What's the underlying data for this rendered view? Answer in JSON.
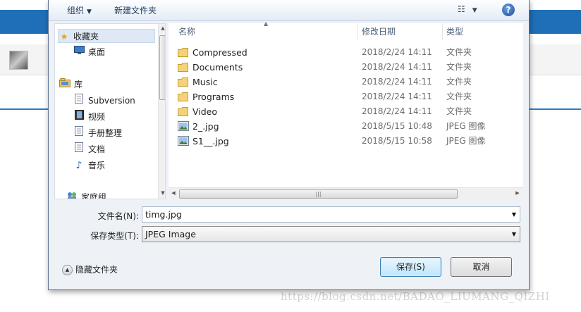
{
  "toolbar": {
    "organize": "组织",
    "new_folder": "新建文件夹",
    "help": "?"
  },
  "nav": {
    "items": [
      {
        "label": "收藏夹",
        "icon": "star-icon"
      },
      {
        "label": "桌面",
        "icon": "desktop-icon"
      },
      {
        "label": "库",
        "icon": "library-icon"
      },
      {
        "label": "Subversion",
        "icon": "document-icon"
      },
      {
        "label": "视频",
        "icon": "video-icon"
      },
      {
        "label": "手册整理",
        "icon": "document-icon"
      },
      {
        "label": "文档",
        "icon": "document-icon"
      },
      {
        "label": "音乐",
        "icon": "music-icon"
      },
      {
        "label": "家庭组",
        "icon": "homegroup-icon"
      }
    ]
  },
  "columns": {
    "name": "名称",
    "date": "修改日期",
    "type": "类型"
  },
  "files": [
    {
      "name": "Compressed",
      "date": "2018/2/24 14:11",
      "type": "文件夹",
      "icon": "folder-icon"
    },
    {
      "name": "Documents",
      "date": "2018/2/24 14:11",
      "type": "文件夹",
      "icon": "folder-icon"
    },
    {
      "name": "Music",
      "date": "2018/2/24 14:11",
      "type": "文件夹",
      "icon": "folder-icon"
    },
    {
      "name": "Programs",
      "date": "2018/2/24 14:11",
      "type": "文件夹",
      "icon": "folder-icon"
    },
    {
      "name": "Video",
      "date": "2018/2/24 14:11",
      "type": "文件夹",
      "icon": "folder-icon"
    },
    {
      "name": "2_.jpg",
      "date": "2018/5/15 10:48",
      "type": "JPEG 图像",
      "icon": "image-icon"
    },
    {
      "name": "S1__.jpg",
      "date": "2018/5/15 10:58",
      "type": "JPEG 图像",
      "icon": "image-icon"
    }
  ],
  "form": {
    "filename_label": "文件名(N):",
    "filename_value": "timg.jpg",
    "filetype_label": "保存类型(T):",
    "filetype_value": "JPEG Image"
  },
  "footer": {
    "hide_folders": "隐藏文件夹",
    "save": "保存(S)",
    "cancel": "取消"
  },
  "watermark": "https://blog.csdn.net/BADAO_LIUMANG_QIZHI"
}
